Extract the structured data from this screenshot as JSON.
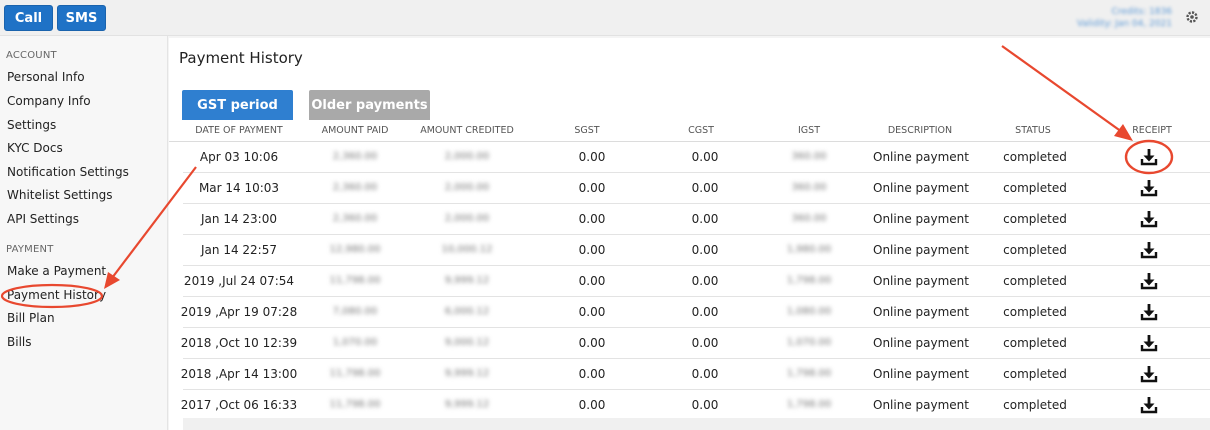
{
  "topbar": {
    "call_label": "Call",
    "sms_label": "SMS",
    "credits_line1": "Credits: 1836",
    "credits_line2": "Validity: Jan 04, 2021",
    "settings_icon": "gear-icon"
  },
  "sidebar": {
    "account_heading": "ACCOUNT",
    "account_items": [
      {
        "label": "Personal Info"
      },
      {
        "label": "Company Info"
      },
      {
        "label": "Settings"
      },
      {
        "label": "KYC Docs"
      },
      {
        "label": "Notification Settings"
      },
      {
        "label": "Whitelist Settings"
      },
      {
        "label": "API Settings"
      }
    ],
    "payment_heading": "PAYMENT",
    "payment_items": [
      {
        "label": "Make a Payment"
      },
      {
        "label": "Payment History"
      },
      {
        "label": "Bill Plan"
      },
      {
        "label": "Bills"
      }
    ]
  },
  "main": {
    "title": "Payment History",
    "tabs": [
      {
        "label": "GST period",
        "active": true
      },
      {
        "label": "Older payments",
        "active": false
      }
    ],
    "columns": [
      "DATE OF PAYMENT",
      "AMOUNT PAID",
      "AMOUNT CREDITED",
      "SGST",
      "CGST",
      "IGST",
      "DESCRIPTION",
      "STATUS",
      "RECEIPT"
    ],
    "rows": [
      {
        "date": "Apr 03 10:06",
        "amount_paid": "2,360.00",
        "amount_credited": "2,000.00",
        "sgst": "0.00",
        "cgst": "0.00",
        "igst": "360.00",
        "description": "Online payment",
        "status": "completed"
      },
      {
        "date": "Mar 14 10:03",
        "amount_paid": "2,360.00",
        "amount_credited": "2,000.00",
        "sgst": "0.00",
        "cgst": "0.00",
        "igst": "360.00",
        "description": "Online payment",
        "status": "completed"
      },
      {
        "date": "Jan 14 23:00",
        "amount_paid": "2,360.00",
        "amount_credited": "2,000.00",
        "sgst": "0.00",
        "cgst": "0.00",
        "igst": "360.00",
        "description": "Online payment",
        "status": "completed"
      },
      {
        "date": "Jan 14 22:57",
        "amount_paid": "12,980.00",
        "amount_credited": "10,000.12",
        "sgst": "0.00",
        "cgst": "0.00",
        "igst": "1,980.00",
        "description": "Online payment",
        "status": "completed"
      },
      {
        "date": "2019 ,Jul 24 07:54",
        "amount_paid": "11,798.00",
        "amount_credited": "9,999.12",
        "sgst": "0.00",
        "cgst": "0.00",
        "igst": "1,798.00",
        "description": "Online payment",
        "status": "completed"
      },
      {
        "date": "2019 ,Apr 19 07:28",
        "amount_paid": "7,080.00",
        "amount_credited": "6,000.12",
        "sgst": "0.00",
        "cgst": "0.00",
        "igst": "1,080.00",
        "description": "Online payment",
        "status": "completed"
      },
      {
        "date": "2018 ,Oct 10 12:39",
        "amount_paid": "1,070.00",
        "amount_credited": "9,000.12",
        "sgst": "0.00",
        "cgst": "0.00",
        "igst": "1,070.00",
        "description": "Online payment",
        "status": "completed"
      },
      {
        "date": "2018 ,Apr 14 13:00",
        "amount_paid": "11,798.00",
        "amount_credited": "9,999.12",
        "sgst": "0.00",
        "cgst": "0.00",
        "igst": "1,798.00",
        "description": "Online payment",
        "status": "completed"
      },
      {
        "date": "2017 ,Oct 06 16:33",
        "amount_paid": "11,798.00",
        "amount_credited": "9,999.12",
        "sgst": "0.00",
        "cgst": "0.00",
        "igst": "1,798.00",
        "description": "Online payment",
        "status": "completed"
      }
    ]
  },
  "colors": {
    "primary_button": "#1f72c6",
    "active_tab": "#2f7fd0",
    "inactive_tab": "#a9a9a9",
    "annotation": "#e8482f"
  }
}
